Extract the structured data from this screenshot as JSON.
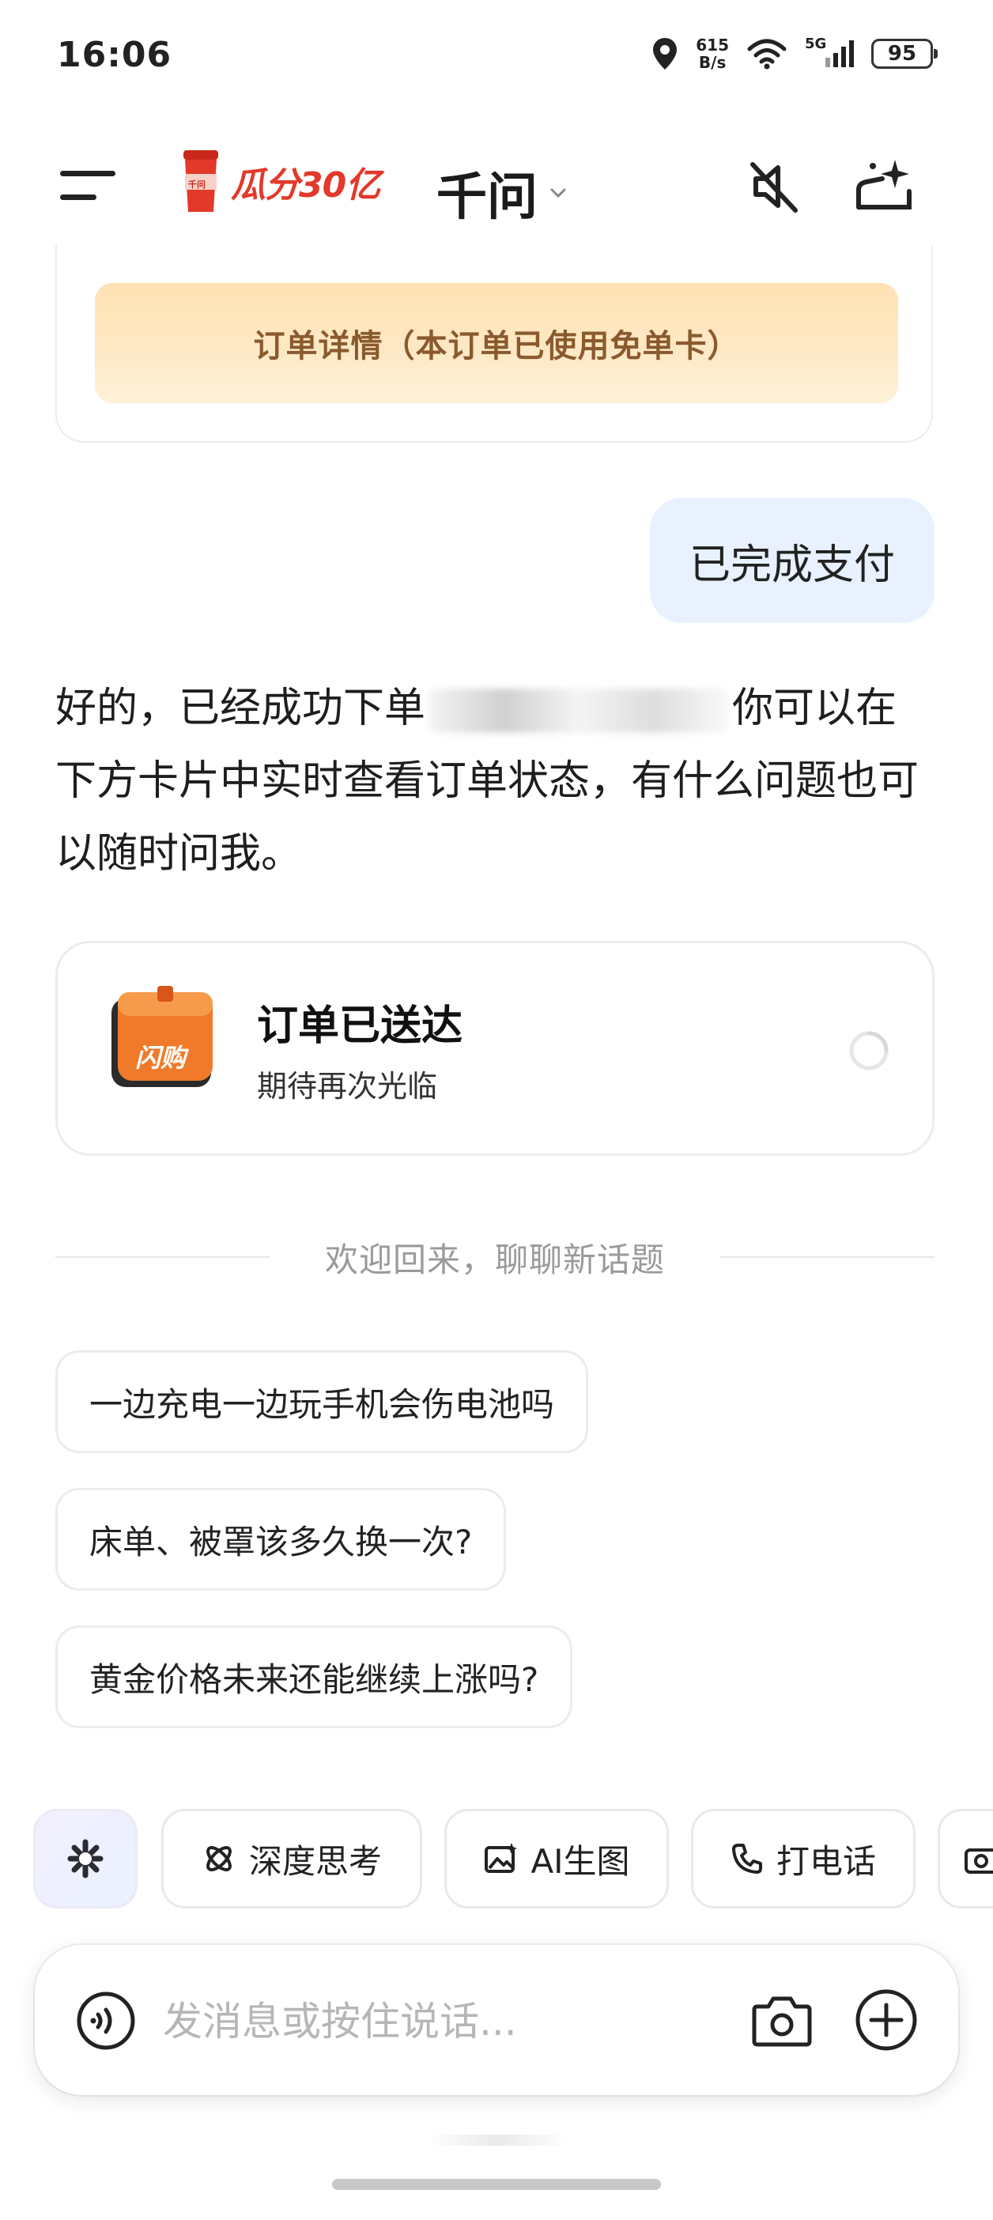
{
  "status_bar": {
    "time": "16:06",
    "net_speed_value": "615",
    "net_speed_unit": "B/s",
    "network_type": "5G",
    "battery": "95"
  },
  "header": {
    "promo_cup_text": "千问",
    "promo_text": "瓜分30亿",
    "title": "千问",
    "icons": [
      "menu-icon",
      "mute-icon",
      "new-chat-sparkle-icon"
    ]
  },
  "conversation": {
    "order_detail_button": "订单详情（本订单已使用免单卡）",
    "user_message": "已完成支付",
    "ai_reply_part1": "好的，已经成功下单",
    "ai_reply_part2": "你可以在下方卡片中实时查看订单状态，有什么问题也可以随时问我。",
    "delivery_card": {
      "icon_text": "闪购",
      "title": "订单已送达",
      "subtitle": "期待再次光临"
    }
  },
  "welcome_divider": "欢迎回来，聊聊新话题",
  "suggestions": [
    "一边充电一边玩手机会伤电池吗",
    "床单、被罩该多久换一次?",
    "黄金价格未来还能继续上涨吗?"
  ],
  "tools": [
    {
      "label": "",
      "icon": "sparkle-logo-icon"
    },
    {
      "label": "深度思考",
      "icon": "deep-think-icon"
    },
    {
      "label": "AI生图",
      "icon": "image-gen-icon"
    },
    {
      "label": "打电话",
      "icon": "phone-icon"
    }
  ],
  "input": {
    "placeholder": "发消息或按住说话..."
  },
  "colors": {
    "accent_red": "#e2392b",
    "user_bubble": "#e8f1fd",
    "order_button_text": "#8a5a2e",
    "delivery_box_orange": "#f07a2a"
  }
}
